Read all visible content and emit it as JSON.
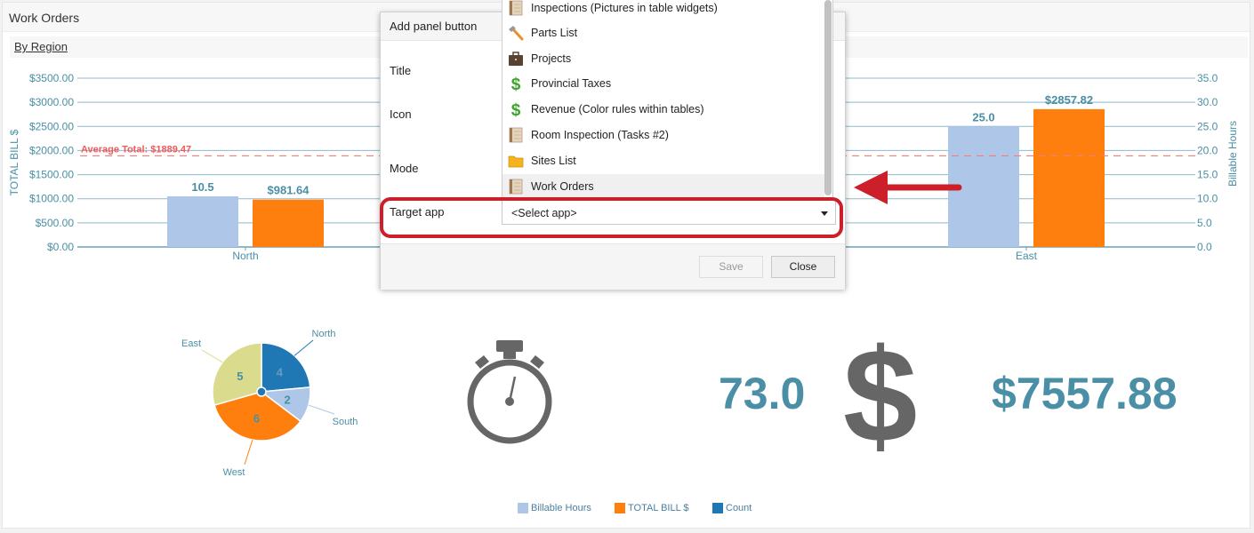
{
  "panel": {
    "title": "Work Orders",
    "subtitle": "By Region"
  },
  "colors": {
    "billable_hours": "#aec7e8",
    "total_bill": "#ff7f0e",
    "count": "#1f77b4",
    "axis_text": "#4a8fa5",
    "grid": "#8fb9c9",
    "average_line": "#f08080",
    "kpi_text": "#4a8fa5",
    "icon_gray": "#666666",
    "highlight": "#cc1f2a"
  },
  "chart_data": [
    {
      "type": "bar",
      "title": "By Region",
      "categories": [
        "North",
        "South",
        "West",
        "East"
      ],
      "visible_categories": [
        "North",
        "East"
      ],
      "ylabel": "TOTAL BILL $",
      "y2label": "Billable Hours",
      "ylim": [
        0,
        3500
      ],
      "y2lim": [
        0,
        35
      ],
      "y_ticks": [
        "$0.00",
        "$500.00",
        "$1000.00",
        "$1500.00",
        "$2000.00",
        "$2500.00",
        "$3000.00",
        "$3500.00"
      ],
      "y2_ticks": [
        "0.0",
        "5.0",
        "10.0",
        "15.0",
        "20.0",
        "25.0",
        "30.0",
        "35.0"
      ],
      "grid": true,
      "series": [
        {
          "name": "Billable Hours",
          "axis": "right",
          "values": {
            "North": 10.5,
            "East": 25.0
          },
          "labels": {
            "North": "10.5",
            "East": "25.0"
          }
        },
        {
          "name": "TOTAL BILL $",
          "axis": "left",
          "values": {
            "North": 981.64,
            "East": 2857.82
          },
          "labels": {
            "North": "$981.64",
            "East": "$2857.82"
          }
        }
      ],
      "annotations": [
        {
          "type": "hline",
          "value": 1889.47,
          "label": "Average Total: $1889.47"
        }
      ]
    },
    {
      "type": "pie",
      "series_name": "Count",
      "categories": [
        "North",
        "South",
        "West",
        "East"
      ],
      "values": [
        4,
        2,
        6,
        5
      ],
      "colors": [
        "#1f77b4",
        "#aec7e8",
        "#ff7f0e",
        "#dbdb8d"
      ]
    }
  ],
  "kpis": {
    "hours_total": "73.0",
    "bill_total": "$7557.88"
  },
  "legend": [
    {
      "label": "Billable Hours",
      "color": "#aec7e8"
    },
    {
      "label": "TOTAL BILL $",
      "color": "#ff7f0e"
    },
    {
      "label": "Count",
      "color": "#1f77b4"
    }
  ],
  "dialog": {
    "title": "Add panel button",
    "labels": {
      "title": "Title",
      "icon": "Icon",
      "mode": "Mode",
      "target_app": "Target app"
    },
    "select_value": "<Select app>",
    "options": [
      {
        "label": "Inspections (Pictures in table widgets)",
        "icon": "notepad-icon"
      },
      {
        "label": "Parts List",
        "icon": "hammer-icon"
      },
      {
        "label": "Projects",
        "icon": "briefcase-icon"
      },
      {
        "label": "Provincial Taxes",
        "icon": "dollar-icon"
      },
      {
        "label": "Revenue (Color rules within tables)",
        "icon": "dollar-icon"
      },
      {
        "label": "Room Inspection (Tasks #2)",
        "icon": "notepad-icon"
      },
      {
        "label": "Sites List",
        "icon": "folder-icon"
      },
      {
        "label": "Work Orders",
        "icon": "notepad-icon"
      }
    ],
    "hovered_option": "Work Orders",
    "save_label": "Save",
    "close_label": "Close"
  }
}
